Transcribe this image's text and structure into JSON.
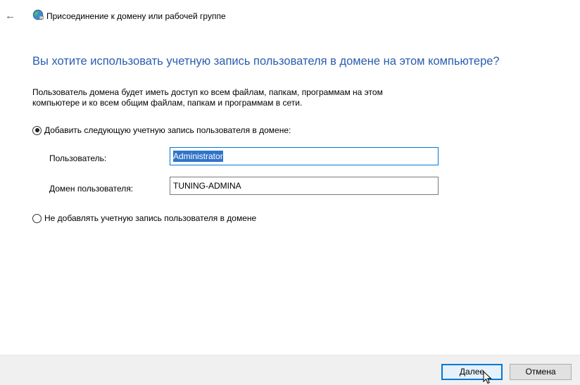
{
  "window": {
    "title": "Присоединение к домену или рабочей группе",
    "back_glyph": "←"
  },
  "main": {
    "heading": "Вы хотите использовать учетную запись пользователя в домене на этом компьютере?",
    "description_line1": "Пользователь домена будет иметь доступ ко всем файлам, папкам, программам на этом",
    "description_line2": "компьютере и ко всем общим файлам, папкам и программам в сети."
  },
  "options": {
    "add_label": "Добавить следующую учетную запись пользователя в домене:",
    "add_selected": true,
    "skip_label": "Не добавлять учетную запись пользователя в домене",
    "skip_selected": false
  },
  "form": {
    "user_label": "Пользователь:",
    "user_value": "Administrator",
    "domain_label": "Домен пользователя:",
    "domain_value": "TUNING-ADMINA"
  },
  "footer": {
    "next_label": "Далее",
    "cancel_label": "Отмена"
  },
  "colors": {
    "heading": "#2a5db0",
    "focus": "#0078d7",
    "selection": "#3074c8",
    "footer_bg": "#f0f0f0"
  },
  "icons": {
    "back": "back-arrow-icon",
    "title": "network-globe-icon",
    "cursor": "mouse-pointer-icon"
  }
}
